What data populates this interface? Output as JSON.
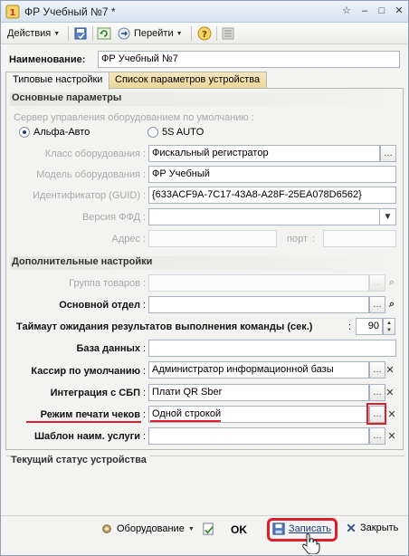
{
  "window": {
    "title": "ФР Учебный №7 *"
  },
  "toolbar": {
    "actions_label": "Действия",
    "goto_label": "Перейти"
  },
  "name_field": {
    "label": "Наименование:",
    "value": "ФР Учебный №7"
  },
  "tabs": [
    {
      "label": "Типовые настройки",
      "active": true
    },
    {
      "label": "Список параметров устройства",
      "active": false
    }
  ],
  "main_params": {
    "heading": "Основные параметры",
    "server_label": "Сервер управления оборудованием по умолчанию :",
    "radio_options": [
      {
        "label": "Альфа-Авто",
        "selected": true
      },
      {
        "label": "5S AUTO",
        "selected": false
      }
    ],
    "fields": {
      "equip_class": {
        "label": "Класс оборудования",
        "value": "Фискальный регистратор"
      },
      "equip_model": {
        "label": "Модель оборудования",
        "value": "ФР Учебный"
      },
      "guid": {
        "label": "Идентификатор (GUID)",
        "value": "{633ACF9A-7C17-43A8-A28F-25EA078D6562}"
      },
      "ffd": {
        "label": "Версия ФФД",
        "value": ""
      },
      "address": {
        "label": "Адрес",
        "value": ""
      },
      "port": {
        "label": "порт",
        "value": ""
      }
    }
  },
  "extra_params": {
    "heading": "Дополнительные настройки",
    "fields": {
      "goods_group": {
        "label": "Группа товаров",
        "value": ""
      },
      "main_dept": {
        "label": "Основной отдел",
        "value": ""
      },
      "timeout": {
        "label": "Таймаут ожидания результатов выполнения команды (сек.)",
        "value": "90"
      },
      "database": {
        "label": "База данных",
        "value": ""
      },
      "cashier": {
        "label": "Кассир по умолчанию",
        "value": "Администратор информационной базы"
      },
      "sbp": {
        "label": "Интеграция с СБП",
        "value": "Плати QR Sber"
      },
      "print_mode": {
        "label": "Режим печати чеков",
        "value": "Одной строкой"
      },
      "service_template": {
        "label": "Шаблон наим. услуги",
        "value": ""
      }
    }
  },
  "status": {
    "heading": "Текущий статус устройства"
  },
  "bottom": {
    "equipment_label": "Оборудование",
    "ok_label": "OK",
    "save_label": "Записать",
    "close_label": "Закрыть"
  },
  "colors": {
    "highlight": "#e11d2a",
    "section_text": "#333333",
    "window_bg": "#f3f3f1"
  }
}
